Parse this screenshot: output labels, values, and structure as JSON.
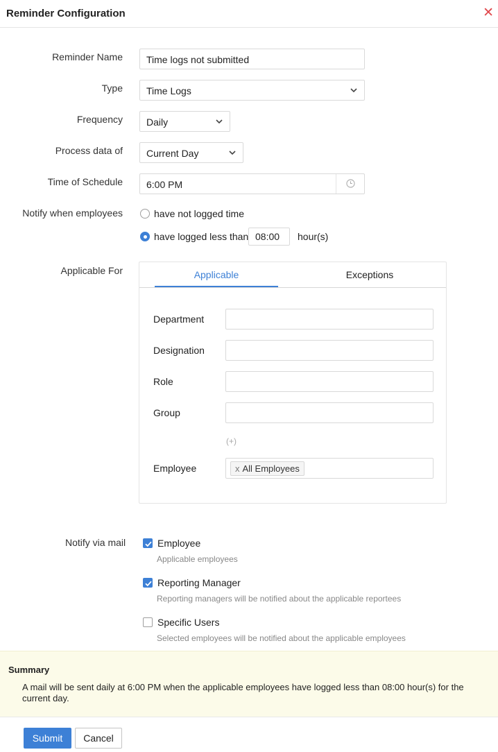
{
  "header": {
    "title": "Reminder Configuration",
    "close_glyph": "✕"
  },
  "form": {
    "reminder_name": {
      "label": "Reminder Name",
      "value": "Time logs not submitted"
    },
    "type": {
      "label": "Type",
      "value": "Time Logs"
    },
    "frequency": {
      "label": "Frequency",
      "value": "Daily"
    },
    "process_data": {
      "label": "Process data of",
      "value": "Current Day"
    },
    "schedule": {
      "label": "Time of Schedule",
      "value": "6:00 PM"
    },
    "notify": {
      "label": "Notify when employees",
      "option_not_logged": "have not logged time",
      "option_less_than": "have logged less than",
      "hours_value": "08:00",
      "hours_unit": "hour(s)",
      "selected": "less_than"
    }
  },
  "applicable": {
    "label": "Applicable For",
    "tabs": [
      {
        "label": "Applicable",
        "active": true
      },
      {
        "label": "Exceptions",
        "active": false
      }
    ],
    "fields": {
      "department": "Department",
      "designation": "Designation",
      "role": "Role",
      "group": "Group",
      "employee": "Employee"
    },
    "add_more": "(+)",
    "employee_chip": "All Employees",
    "chip_remove": "x"
  },
  "notify_mail": {
    "label": "Notify via mail",
    "options": [
      {
        "label": "Employee",
        "help": "Applicable employees",
        "checked": true
      },
      {
        "label": "Reporting Manager",
        "help": "Reporting managers will be notified about the applicable reportees",
        "checked": true
      },
      {
        "label": "Specific Users",
        "help": "Selected employees will be notified about the applicable employees",
        "checked": false
      }
    ]
  },
  "summary": {
    "title": "Summary",
    "text": "A mail will be sent daily at 6:00 PM when the applicable employees have logged less than 08:00 hour(s) for the current day."
  },
  "actions": {
    "submit": "Submit",
    "cancel": "Cancel"
  },
  "colors": {
    "accent": "#3d80d6",
    "close": "#e0484c",
    "summary_bg": "#fcfbe9"
  }
}
